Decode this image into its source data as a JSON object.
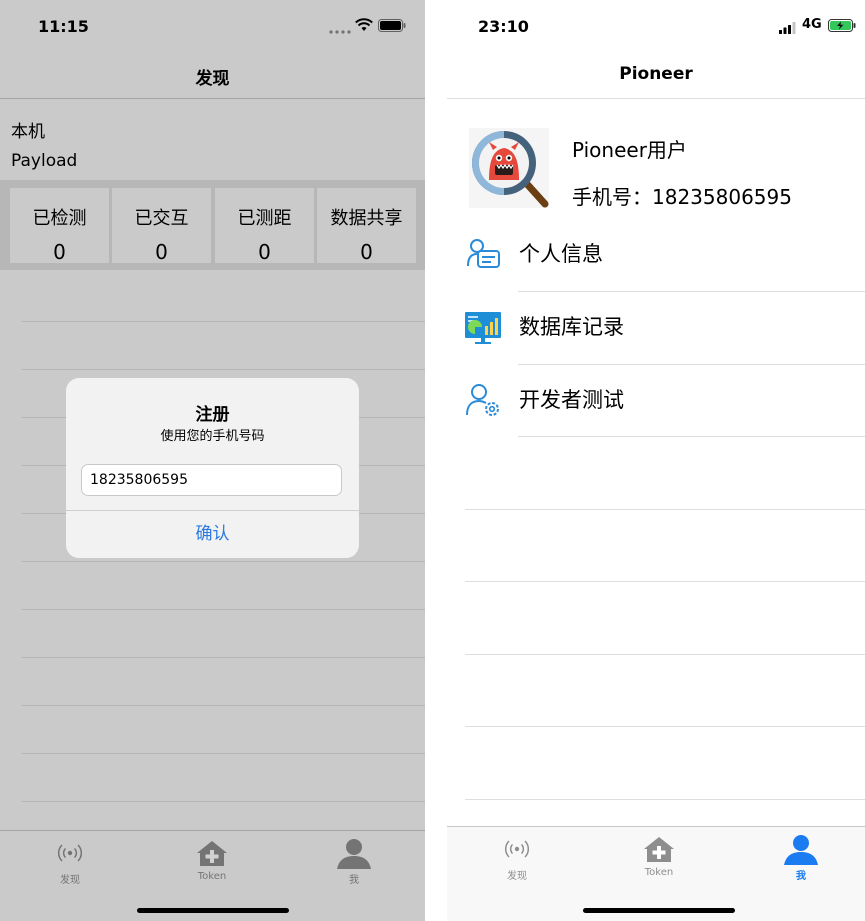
{
  "left": {
    "status": {
      "time": "11:15"
    },
    "nav": {
      "title": "发现"
    },
    "device": {
      "line1": "本机",
      "line2": "Payload"
    },
    "stats": [
      {
        "label": "已检测",
        "value": "0"
      },
      {
        "label": "已交互",
        "value": "0"
      },
      {
        "label": "已测距",
        "value": "0"
      },
      {
        "label": "数据共享",
        "value": "0"
      }
    ],
    "dialog": {
      "title": "注册",
      "message": "使用您的手机号码",
      "input_value": "18235806595",
      "confirm_label": "确认"
    },
    "tabs": [
      {
        "label": "发现",
        "icon": "radio-waves-icon"
      },
      {
        "label": "Token",
        "icon": "home-plus-icon"
      },
      {
        "label": "我",
        "icon": "person-icon"
      }
    ]
  },
  "right": {
    "status": {
      "time": "23:10",
      "network": "4G"
    },
    "nav": {
      "title": "Pioneer"
    },
    "profile": {
      "name": "Pioneer用户",
      "phone": "手机号：18235806595"
    },
    "menu": [
      {
        "label": "个人信息",
        "icon": "id-card-icon"
      },
      {
        "label": "数据库记录",
        "icon": "database-chart-icon"
      },
      {
        "label": "开发者测试",
        "icon": "user-settings-icon"
      }
    ],
    "tabs": [
      {
        "label": "发现",
        "icon": "radio-waves-icon"
      },
      {
        "label": "Token",
        "icon": "home-plus-icon"
      },
      {
        "label": "我",
        "icon": "person-icon",
        "active": true
      }
    ]
  },
  "colors": {
    "accent": "#1a7cf0",
    "dialog_button": "#2a7ae2",
    "tab_inactive": "#8e8e8e",
    "menu_icon": "#2a8bd8"
  }
}
